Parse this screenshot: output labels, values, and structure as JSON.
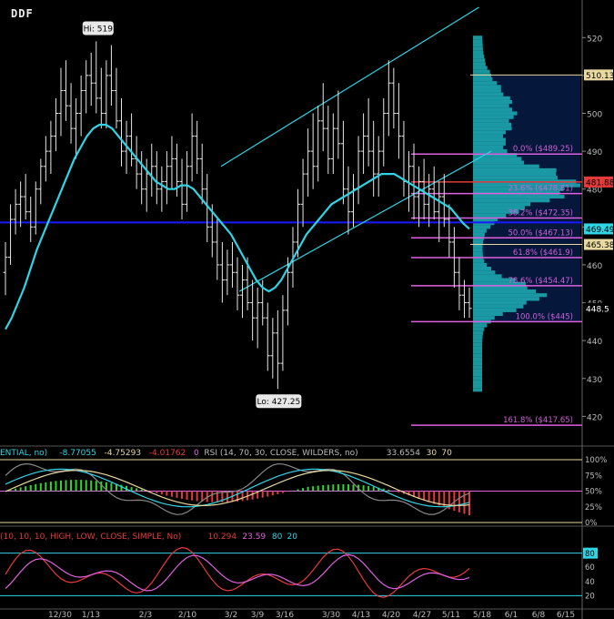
{
  "ticker": "DDF",
  "colors": {
    "bg": "#000000",
    "bar": "#e6e6e6",
    "ma": "#2fd5e6",
    "channel": "#2fd5e6",
    "fib": "#e060e0",
    "fib_text": "#d060d8",
    "blueline": "#1a1aff",
    "poc": "#e8d9a0",
    "red": "#e63a3a",
    "green": "#2ed82e",
    "profile": "#1fb0b8",
    "profile_dark": "#0a2a6a",
    "grid": "#333333",
    "axis_text": "#bbbbbb"
  },
  "chart_data": [
    {
      "type": "ohlc",
      "title": "",
      "y_ticks": [
        420,
        430,
        440,
        450,
        460,
        470,
        480,
        490,
        500,
        510,
        520
      ],
      "ylim": [
        416,
        528
      ],
      "x_ticks": [
        "12/30",
        "1/13",
        "2/3",
        "2/10",
        "3/2",
        "3/9",
        "3/16",
        "3/30",
        "4/13",
        "4/20",
        "4/27",
        "5/11",
        "5/18",
        "6/1",
        "6/8",
        "6/15"
      ],
      "annotations": {
        "hi": "Hi: 519",
        "lo": "Lo: 427.25"
      },
      "price_labels": [
        {
          "text": "510.13",
          "value": 510.13,
          "color": "#e8d9a0",
          "text_color": "#000000"
        },
        {
          "text": "481.88",
          "value": 481.88,
          "color": "#e63a3a",
          "text_color": "#000000"
        },
        {
          "text": "469.49",
          "value": 469.49,
          "color": "#2fd5e6",
          "text_color": "#000000"
        },
        {
          "text": "465.38",
          "value": 465.38,
          "color": "#e8d9a0",
          "text_color": "#000000"
        },
        {
          "text": "448.5",
          "value": 448.5,
          "color": "#000000",
          "text_color": "#ffffff"
        }
      ],
      "fib_levels": [
        {
          "label": "0.0% ($489.25)",
          "value": 489.25
        },
        {
          "label": "23.6% ($478.81)",
          "value": 478.81
        },
        {
          "label": "38.2% ($472.35)",
          "value": 472.35
        },
        {
          "label": "50.0% ($467.13)",
          "value": 467.13
        },
        {
          "label": "61.8% ($461.9)",
          "value": 461.9
        },
        {
          "label": "78.6% ($454.47)",
          "value": 454.47
        },
        {
          "label": "100.0% ($445)",
          "value": 445
        },
        {
          "label": "161.8% ($417.65)",
          "value": 417.65
        }
      ],
      "blue_level": 471.2,
      "ohlc": [
        {
          "o": 458,
          "h": 466,
          "l": 452,
          "c": 462
        },
        {
          "o": 462,
          "h": 476,
          "l": 460,
          "c": 472
        },
        {
          "o": 472,
          "h": 480,
          "l": 468,
          "c": 476
        },
        {
          "o": 476,
          "h": 482,
          "l": 470,
          "c": 478
        },
        {
          "o": 478,
          "h": 484,
          "l": 472,
          "c": 474
        },
        {
          "o": 474,
          "h": 478,
          "l": 466,
          "c": 470
        },
        {
          "o": 470,
          "h": 482,
          "l": 468,
          "c": 480
        },
        {
          "o": 480,
          "h": 488,
          "l": 476,
          "c": 486
        },
        {
          "o": 486,
          "h": 494,
          "l": 482,
          "c": 490
        },
        {
          "o": 490,
          "h": 498,
          "l": 484,
          "c": 494
        },
        {
          "o": 494,
          "h": 504,
          "l": 490,
          "c": 500
        },
        {
          "o": 500,
          "h": 512,
          "l": 494,
          "c": 506
        },
        {
          "o": 506,
          "h": 514,
          "l": 498,
          "c": 502
        },
        {
          "o": 502,
          "h": 508,
          "l": 492,
          "c": 496
        },
        {
          "o": 496,
          "h": 504,
          "l": 488,
          "c": 500
        },
        {
          "o": 500,
          "h": 510,
          "l": 494,
          "c": 506
        },
        {
          "o": 506,
          "h": 514,
          "l": 500,
          "c": 510
        },
        {
          "o": 510,
          "h": 516,
          "l": 502,
          "c": 508
        },
        {
          "o": 508,
          "h": 519,
          "l": 500,
          "c": 504
        },
        {
          "o": 504,
          "h": 512,
          "l": 496,
          "c": 500
        },
        {
          "o": 500,
          "h": 514,
          "l": 496,
          "c": 510
        },
        {
          "o": 510,
          "h": 518,
          "l": 502,
          "c": 506
        },
        {
          "o": 506,
          "h": 512,
          "l": 496,
          "c": 498
        },
        {
          "o": 498,
          "h": 504,
          "l": 486,
          "c": 490
        },
        {
          "o": 490,
          "h": 498,
          "l": 484,
          "c": 494
        },
        {
          "o": 494,
          "h": 500,
          "l": 486,
          "c": 488
        },
        {
          "o": 488,
          "h": 494,
          "l": 480,
          "c": 484
        },
        {
          "o": 484,
          "h": 490,
          "l": 476,
          "c": 480
        },
        {
          "o": 480,
          "h": 488,
          "l": 474,
          "c": 484
        },
        {
          "o": 484,
          "h": 492,
          "l": 478,
          "c": 486
        },
        {
          "o": 486,
          "h": 490,
          "l": 476,
          "c": 480
        },
        {
          "o": 480,
          "h": 486,
          "l": 474,
          "c": 482
        },
        {
          "o": 482,
          "h": 490,
          "l": 476,
          "c": 486
        },
        {
          "o": 486,
          "h": 494,
          "l": 480,
          "c": 488
        },
        {
          "o": 488,
          "h": 492,
          "l": 478,
          "c": 482
        },
        {
          "o": 482,
          "h": 488,
          "l": 472,
          "c": 476
        },
        {
          "o": 476,
          "h": 490,
          "l": 474,
          "c": 486
        },
        {
          "o": 486,
          "h": 500,
          "l": 482,
          "c": 494
        },
        {
          "o": 494,
          "h": 498,
          "l": 484,
          "c": 488
        },
        {
          "o": 488,
          "h": 492,
          "l": 476,
          "c": 480
        },
        {
          "o": 480,
          "h": 484,
          "l": 466,
          "c": 470
        },
        {
          "o": 470,
          "h": 476,
          "l": 462,
          "c": 466
        },
        {
          "o": 466,
          "h": 472,
          "l": 456,
          "c": 460
        },
        {
          "o": 460,
          "h": 466,
          "l": 450,
          "c": 456
        },
        {
          "o": 456,
          "h": 464,
          "l": 452,
          "c": 460
        },
        {
          "o": 460,
          "h": 466,
          "l": 454,
          "c": 458
        },
        {
          "o": 458,
          "h": 462,
          "l": 448,
          "c": 452
        },
        {
          "o": 452,
          "h": 460,
          "l": 446,
          "c": 456
        },
        {
          "o": 456,
          "h": 462,
          "l": 448,
          "c": 450
        },
        {
          "o": 450,
          "h": 456,
          "l": 440,
          "c": 446
        },
        {
          "o": 446,
          "h": 454,
          "l": 438,
          "c": 450
        },
        {
          "o": 450,
          "h": 456,
          "l": 444,
          "c": 446
        },
        {
          "o": 446,
          "h": 450,
          "l": 432,
          "c": 436
        },
        {
          "o": 436,
          "h": 446,
          "l": 430,
          "c": 442
        },
        {
          "o": 442,
          "h": 448,
          "l": 427.25,
          "c": 434
        },
        {
          "o": 434,
          "h": 452,
          "l": 432,
          "c": 448
        },
        {
          "o": 448,
          "h": 462,
          "l": 444,
          "c": 458
        },
        {
          "o": 458,
          "h": 470,
          "l": 454,
          "c": 466
        },
        {
          "o": 466,
          "h": 480,
          "l": 462,
          "c": 476
        },
        {
          "o": 476,
          "h": 488,
          "l": 470,
          "c": 484
        },
        {
          "o": 484,
          "h": 496,
          "l": 478,
          "c": 490
        },
        {
          "o": 490,
          "h": 500,
          "l": 480,
          "c": 486
        },
        {
          "o": 486,
          "h": 502,
          "l": 482,
          "c": 498
        },
        {
          "o": 498,
          "h": 508,
          "l": 490,
          "c": 496
        },
        {
          "o": 496,
          "h": 502,
          "l": 484,
          "c": 488
        },
        {
          "o": 488,
          "h": 500,
          "l": 484,
          "c": 496
        },
        {
          "o": 496,
          "h": 506,
          "l": 488,
          "c": 492
        },
        {
          "o": 492,
          "h": 498,
          "l": 476,
          "c": 480
        },
        {
          "o": 480,
          "h": 486,
          "l": 468,
          "c": 474
        },
        {
          "o": 474,
          "h": 484,
          "l": 470,
          "c": 480
        },
        {
          "o": 480,
          "h": 494,
          "l": 476,
          "c": 490
        },
        {
          "o": 490,
          "h": 500,
          "l": 484,
          "c": 494
        },
        {
          "o": 494,
          "h": 504,
          "l": 486,
          "c": 490
        },
        {
          "o": 490,
          "h": 498,
          "l": 478,
          "c": 484
        },
        {
          "o": 484,
          "h": 494,
          "l": 478,
          "c": 490
        },
        {
          "o": 490,
          "h": 504,
          "l": 486,
          "c": 500
        },
        {
          "o": 500,
          "h": 514,
          "l": 494,
          "c": 508
        },
        {
          "o": 508,
          "h": 512,
          "l": 496,
          "c": 500
        },
        {
          "o": 500,
          "h": 508,
          "l": 488,
          "c": 494
        },
        {
          "o": 494,
          "h": 498,
          "l": 478,
          "c": 482
        },
        {
          "o": 482,
          "h": 490,
          "l": 474,
          "c": 486
        },
        {
          "o": 486,
          "h": 492,
          "l": 472,
          "c": 478
        },
        {
          "o": 478,
          "h": 486,
          "l": 470,
          "c": 482
        },
        {
          "o": 482,
          "h": 488,
          "l": 472,
          "c": 476
        },
        {
          "o": 476,
          "h": 484,
          "l": 470,
          "c": 480
        },
        {
          "o": 480,
          "h": 486,
          "l": 472,
          "c": 474
        },
        {
          "o": 474,
          "h": 482,
          "l": 466,
          "c": 478
        },
        {
          "o": 478,
          "h": 484,
          "l": 470,
          "c": 472
        },
        {
          "o": 472,
          "h": 476,
          "l": 462,
          "c": 466
        },
        {
          "o": 466,
          "h": 470,
          "l": 454,
          "c": 458
        },
        {
          "o": 458,
          "h": 462,
          "l": 448,
          "c": 452
        },
        {
          "o": 452,
          "h": 456,
          "l": 446,
          "c": 450
        },
        {
          "o": 450,
          "h": 454,
          "l": 446,
          "c": 448.5
        }
      ],
      "ma20": [
        443,
        446,
        450,
        454,
        459,
        464,
        468,
        472,
        476,
        480,
        484,
        488,
        491,
        494,
        496,
        497,
        497,
        496,
        494,
        492,
        490,
        488,
        486,
        484,
        482,
        481,
        480,
        480,
        481,
        481,
        480,
        478,
        476,
        474,
        472,
        470,
        468,
        465,
        462,
        459,
        456,
        454,
        453,
        454,
        456,
        459,
        462,
        465,
        468,
        470,
        472,
        474,
        476,
        477,
        478,
        479,
        480,
        481,
        482,
        483,
        484,
        484,
        484,
        483,
        482,
        481,
        480,
        479,
        478,
        477,
        476,
        475,
        473,
        471,
        469.5
      ],
      "channel_upper": [
        [
          0.36,
          486
        ],
        [
          0.78,
          528
        ]
      ],
      "channel_lower": [
        [
          0.39,
          453
        ],
        [
          0.8,
          490
        ]
      ]
    },
    {
      "type": "line",
      "title": "",
      "header": [
        {
          "text": "ENTIAL, no)",
          "color": "#2fd5e6"
        },
        {
          "text": "-8.77055",
          "color": "#2fd5e6"
        },
        {
          "text": "-4.75293",
          "color": "#e8d9a0"
        },
        {
          "text": "-4.01762",
          "color": "#e63a3a"
        },
        {
          "text": "0",
          "color": "#e060e0"
        },
        {
          "text": "RSI (14, 70, 30, CLOSE, WILDERS, no)",
          "color": "#bbbbbb"
        },
        {
          "text": "33.6554",
          "color": "#bbbbbb"
        },
        {
          "text": "30",
          "color": "#e8d9a0"
        },
        {
          "text": "70",
          "color": "#e8d9a0"
        }
      ],
      "y_ticks": [
        "100%",
        "75%",
        "50%",
        "25%",
        "0%"
      ]
    },
    {
      "type": "line",
      "title": "",
      "header": [
        {
          "text": "(10, 10, 10, HIGH, LOW, CLOSE, SIMPLE, No)",
          "color": "#e63a3a"
        },
        {
          "text": "10.294",
          "color": "#e63a3a"
        },
        {
          "text": "23.59",
          "color": "#e060e0"
        },
        {
          "text": "80",
          "color": "#2fd5e6"
        },
        {
          "text": "20",
          "color": "#2fd5e6"
        }
      ],
      "y_ticks": [
        "80",
        "60",
        "40",
        "20"
      ],
      "marker_label": "80"
    }
  ]
}
